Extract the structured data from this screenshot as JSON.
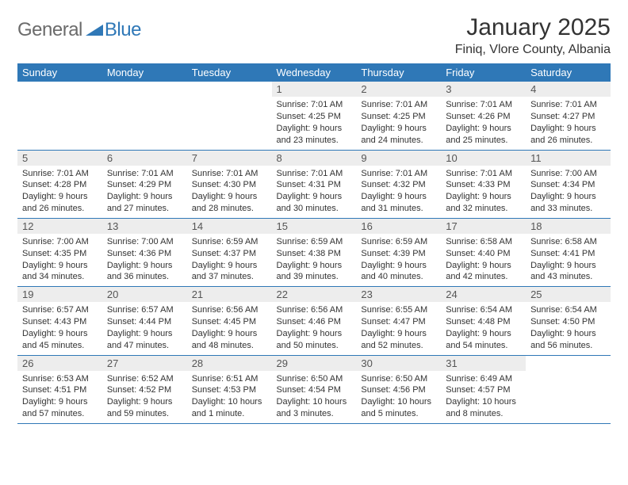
{
  "logo": {
    "part1": "General",
    "part2": "Blue"
  },
  "title": "January 2025",
  "location": "Finiq, Vlore County, Albania",
  "weekdays": [
    "Sunday",
    "Monday",
    "Tuesday",
    "Wednesday",
    "Thursday",
    "Friday",
    "Saturday"
  ],
  "weeks": [
    [
      {
        "n": "",
        "sr": "",
        "ss": "",
        "dl": ""
      },
      {
        "n": "",
        "sr": "",
        "ss": "",
        "dl": ""
      },
      {
        "n": "",
        "sr": "",
        "ss": "",
        "dl": ""
      },
      {
        "n": "1",
        "sr": "Sunrise: 7:01 AM",
        "ss": "Sunset: 4:25 PM",
        "dl": "Daylight: 9 hours and 23 minutes."
      },
      {
        "n": "2",
        "sr": "Sunrise: 7:01 AM",
        "ss": "Sunset: 4:25 PM",
        "dl": "Daylight: 9 hours and 24 minutes."
      },
      {
        "n": "3",
        "sr": "Sunrise: 7:01 AM",
        "ss": "Sunset: 4:26 PM",
        "dl": "Daylight: 9 hours and 25 minutes."
      },
      {
        "n": "4",
        "sr": "Sunrise: 7:01 AM",
        "ss": "Sunset: 4:27 PM",
        "dl": "Daylight: 9 hours and 26 minutes."
      }
    ],
    [
      {
        "n": "5",
        "sr": "Sunrise: 7:01 AM",
        "ss": "Sunset: 4:28 PM",
        "dl": "Daylight: 9 hours and 26 minutes."
      },
      {
        "n": "6",
        "sr": "Sunrise: 7:01 AM",
        "ss": "Sunset: 4:29 PM",
        "dl": "Daylight: 9 hours and 27 minutes."
      },
      {
        "n": "7",
        "sr": "Sunrise: 7:01 AM",
        "ss": "Sunset: 4:30 PM",
        "dl": "Daylight: 9 hours and 28 minutes."
      },
      {
        "n": "8",
        "sr": "Sunrise: 7:01 AM",
        "ss": "Sunset: 4:31 PM",
        "dl": "Daylight: 9 hours and 30 minutes."
      },
      {
        "n": "9",
        "sr": "Sunrise: 7:01 AM",
        "ss": "Sunset: 4:32 PM",
        "dl": "Daylight: 9 hours and 31 minutes."
      },
      {
        "n": "10",
        "sr": "Sunrise: 7:01 AM",
        "ss": "Sunset: 4:33 PM",
        "dl": "Daylight: 9 hours and 32 minutes."
      },
      {
        "n": "11",
        "sr": "Sunrise: 7:00 AM",
        "ss": "Sunset: 4:34 PM",
        "dl": "Daylight: 9 hours and 33 minutes."
      }
    ],
    [
      {
        "n": "12",
        "sr": "Sunrise: 7:00 AM",
        "ss": "Sunset: 4:35 PM",
        "dl": "Daylight: 9 hours and 34 minutes."
      },
      {
        "n": "13",
        "sr": "Sunrise: 7:00 AM",
        "ss": "Sunset: 4:36 PM",
        "dl": "Daylight: 9 hours and 36 minutes."
      },
      {
        "n": "14",
        "sr": "Sunrise: 6:59 AM",
        "ss": "Sunset: 4:37 PM",
        "dl": "Daylight: 9 hours and 37 minutes."
      },
      {
        "n": "15",
        "sr": "Sunrise: 6:59 AM",
        "ss": "Sunset: 4:38 PM",
        "dl": "Daylight: 9 hours and 39 minutes."
      },
      {
        "n": "16",
        "sr": "Sunrise: 6:59 AM",
        "ss": "Sunset: 4:39 PM",
        "dl": "Daylight: 9 hours and 40 minutes."
      },
      {
        "n": "17",
        "sr": "Sunrise: 6:58 AM",
        "ss": "Sunset: 4:40 PM",
        "dl": "Daylight: 9 hours and 42 minutes."
      },
      {
        "n": "18",
        "sr": "Sunrise: 6:58 AM",
        "ss": "Sunset: 4:41 PM",
        "dl": "Daylight: 9 hours and 43 minutes."
      }
    ],
    [
      {
        "n": "19",
        "sr": "Sunrise: 6:57 AM",
        "ss": "Sunset: 4:43 PM",
        "dl": "Daylight: 9 hours and 45 minutes."
      },
      {
        "n": "20",
        "sr": "Sunrise: 6:57 AM",
        "ss": "Sunset: 4:44 PM",
        "dl": "Daylight: 9 hours and 47 minutes."
      },
      {
        "n": "21",
        "sr": "Sunrise: 6:56 AM",
        "ss": "Sunset: 4:45 PM",
        "dl": "Daylight: 9 hours and 48 minutes."
      },
      {
        "n": "22",
        "sr": "Sunrise: 6:56 AM",
        "ss": "Sunset: 4:46 PM",
        "dl": "Daylight: 9 hours and 50 minutes."
      },
      {
        "n": "23",
        "sr": "Sunrise: 6:55 AM",
        "ss": "Sunset: 4:47 PM",
        "dl": "Daylight: 9 hours and 52 minutes."
      },
      {
        "n": "24",
        "sr": "Sunrise: 6:54 AM",
        "ss": "Sunset: 4:48 PM",
        "dl": "Daylight: 9 hours and 54 minutes."
      },
      {
        "n": "25",
        "sr": "Sunrise: 6:54 AM",
        "ss": "Sunset: 4:50 PM",
        "dl": "Daylight: 9 hours and 56 minutes."
      }
    ],
    [
      {
        "n": "26",
        "sr": "Sunrise: 6:53 AM",
        "ss": "Sunset: 4:51 PM",
        "dl": "Daylight: 9 hours and 57 minutes."
      },
      {
        "n": "27",
        "sr": "Sunrise: 6:52 AM",
        "ss": "Sunset: 4:52 PM",
        "dl": "Daylight: 9 hours and 59 minutes."
      },
      {
        "n": "28",
        "sr": "Sunrise: 6:51 AM",
        "ss": "Sunset: 4:53 PM",
        "dl": "Daylight: 10 hours and 1 minute."
      },
      {
        "n": "29",
        "sr": "Sunrise: 6:50 AM",
        "ss": "Sunset: 4:54 PM",
        "dl": "Daylight: 10 hours and 3 minutes."
      },
      {
        "n": "30",
        "sr": "Sunrise: 6:50 AM",
        "ss": "Sunset: 4:56 PM",
        "dl": "Daylight: 10 hours and 5 minutes."
      },
      {
        "n": "31",
        "sr": "Sunrise: 6:49 AM",
        "ss": "Sunset: 4:57 PM",
        "dl": "Daylight: 10 hours and 8 minutes."
      },
      {
        "n": "",
        "sr": "",
        "ss": "",
        "dl": ""
      }
    ]
  ]
}
